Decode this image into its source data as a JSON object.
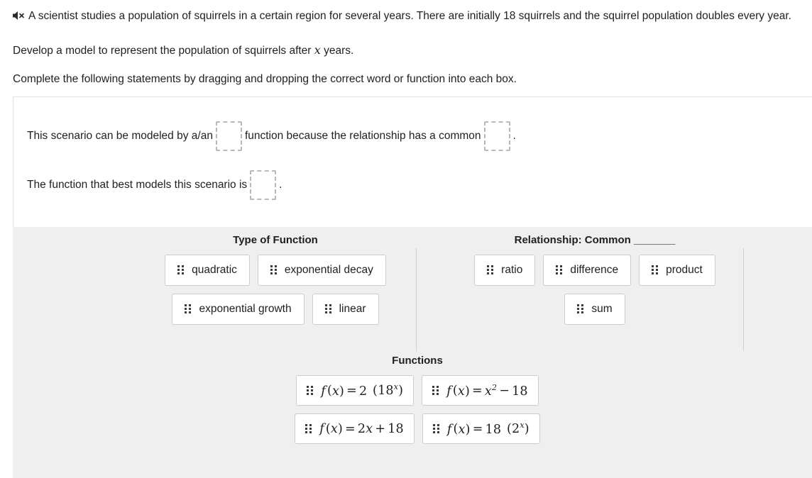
{
  "prompt": {
    "audio_icon": "speaker-mute-icon",
    "line1_part1": "A scientist studies a population of squirrels in a certain region for several years. There are initially 18 squirrels and the squirrel population doubles every",
    "line1_part2": "year.",
    "line2_pre": "Develop a model to represent the population of squirrels after",
    "line2_var": "x",
    "line2_post": "years.",
    "line3": "Complete the following statements by dragging and dropping the correct word or function into each box."
  },
  "statements": {
    "s1_a": "This scenario can be modeled by a/an",
    "s1_b": "function because the relationship has a common",
    "s1_c": ".",
    "s2_a": "The function that best models this scenario is",
    "s2_b": "."
  },
  "bank": {
    "groups": [
      {
        "title": "Type of Function",
        "rows": [
          [
            {
              "label": "quadratic"
            },
            {
              "label": "exponential decay"
            }
          ],
          [
            {
              "label": "exponential growth"
            },
            {
              "label": "linear"
            }
          ]
        ]
      },
      {
        "title": "Relationship: Common _______",
        "rows": [
          [
            {
              "label": "ratio"
            },
            {
              "label": "difference"
            },
            {
              "label": "product"
            }
          ],
          [
            {
              "label": "sum"
            }
          ]
        ]
      },
      {
        "title": "Functions",
        "rows": [
          [
            {
              "label": "f (x) = 2 (18^x)"
            },
            {
              "label": "f (x) = x^2 - 18"
            }
          ],
          [
            {
              "label": "f (x) = 2x + 18"
            },
            {
              "label": "f (x) = 18 (2^x)"
            }
          ]
        ]
      }
    ]
  },
  "colors": {
    "page_bg": "#ffffff",
    "bank_bg": "#efefef",
    "chip_bg": "#ffffff",
    "chip_border": "#cccccc",
    "dropzone_border": "#b9b9b9",
    "divider": "#cfcfcf",
    "text": "#1f1f1f"
  }
}
